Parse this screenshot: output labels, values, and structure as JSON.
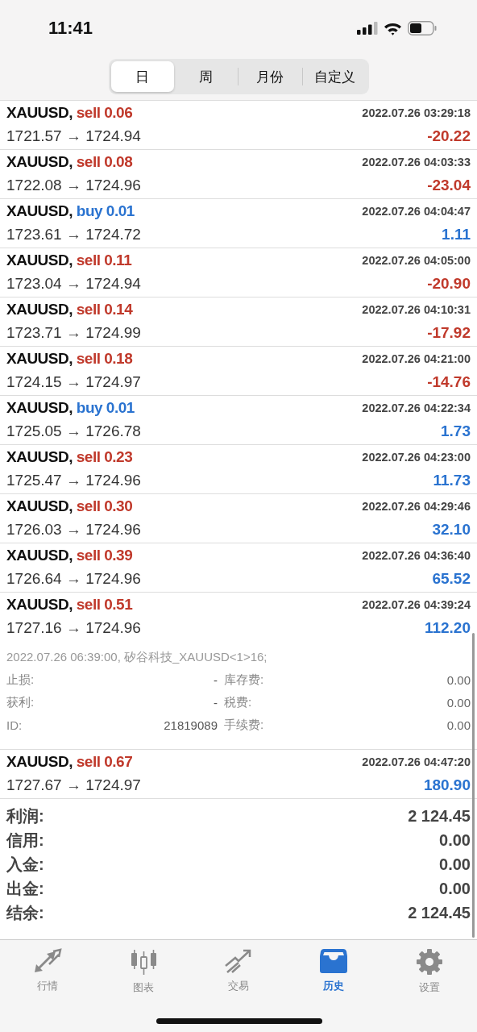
{
  "status_bar": {
    "time": "11:41"
  },
  "period_tabs": [
    {
      "label": "日",
      "selected": true
    },
    {
      "label": "周",
      "selected": false
    },
    {
      "label": "月份",
      "selected": false
    },
    {
      "label": "自定义",
      "selected": false
    }
  ],
  "deals": [
    {
      "symbol": "XAUUSD,",
      "type": "sell",
      "volume": "0.06",
      "time": "2022.07.26 03:29:18",
      "prices": "1721.57 → 1724.94",
      "profit": "-20.22",
      "negative": true
    },
    {
      "symbol": "XAUUSD,",
      "type": "sell",
      "volume": "0.08",
      "time": "2022.07.26 04:03:33",
      "prices": "1722.08 → 1724.96",
      "profit": "-23.04",
      "negative": true
    },
    {
      "symbol": "XAUUSD,",
      "type": "buy",
      "volume": "0.01",
      "time": "2022.07.26 04:04:47",
      "prices": "1723.61 → 1724.72",
      "profit": "1.11",
      "negative": false
    },
    {
      "symbol": "XAUUSD,",
      "type": "sell",
      "volume": "0.11",
      "time": "2022.07.26 04:05:00",
      "prices": "1723.04 → 1724.94",
      "profit": "-20.90",
      "negative": true
    },
    {
      "symbol": "XAUUSD,",
      "type": "sell",
      "volume": "0.14",
      "time": "2022.07.26 04:10:31",
      "prices": "1723.71 → 1724.99",
      "profit": "-17.92",
      "negative": true
    },
    {
      "symbol": "XAUUSD,",
      "type": "sell",
      "volume": "0.18",
      "time": "2022.07.26 04:21:00",
      "prices": "1724.15 → 1724.97",
      "profit": "-14.76",
      "negative": true
    },
    {
      "symbol": "XAUUSD,",
      "type": "buy",
      "volume": "0.01",
      "time": "2022.07.26 04:22:34",
      "prices": "1725.05 → 1726.78",
      "profit": "1.73",
      "negative": false
    },
    {
      "symbol": "XAUUSD,",
      "type": "sell",
      "volume": "0.23",
      "time": "2022.07.26 04:23:00",
      "prices": "1725.47 → 1724.96",
      "profit": "11.73",
      "negative": false
    },
    {
      "symbol": "XAUUSD,",
      "type": "sell",
      "volume": "0.30",
      "time": "2022.07.26 04:29:46",
      "prices": "1726.03 → 1724.96",
      "profit": "32.10",
      "negative": false
    },
    {
      "symbol": "XAUUSD,",
      "type": "sell",
      "volume": "0.39",
      "time": "2022.07.26 04:36:40",
      "prices": "1726.64 → 1724.96",
      "profit": "65.52",
      "negative": false
    },
    {
      "symbol": "XAUUSD,",
      "type": "sell",
      "volume": "0.51",
      "time": "2022.07.26 04:39:24",
      "prices": "1727.16 → 1724.96",
      "profit": "112.20",
      "negative": false,
      "details": {
        "comment": "2022.07.26 06:39:00, 矽谷科技_XAUUSD<1>16;",
        "fields": [
          {
            "label": "止损:",
            "value": "-",
            "label_2": "库存费:",
            "value_2": "0.00"
          },
          {
            "label": "获利:",
            "value": "-",
            "label_2": "税费:",
            "value_2": "0.00"
          },
          {
            "label": "ID:",
            "value": "21819089",
            "label_2": "手续费:",
            "value_2": "0.00"
          }
        ]
      }
    },
    {
      "symbol": "XAUUSD,",
      "type": "sell",
      "volume": "0.67",
      "time": "2022.07.26 04:47:20",
      "prices": "1727.67 → 1724.97",
      "profit": "180.90",
      "negative": false
    }
  ],
  "summary": [
    {
      "label": "利润:",
      "value": "2 124.45"
    },
    {
      "label": "信用:",
      "value": "0.00"
    },
    {
      "label": "入金:",
      "value": "0.00"
    },
    {
      "label": "出金:",
      "value": "0.00"
    },
    {
      "label": "结余:",
      "value": "2 124.45"
    }
  ],
  "bottom_tabs": [
    {
      "label": "行情",
      "kind": "quotes",
      "selected": false
    },
    {
      "label": "图表",
      "kind": "chart",
      "selected": false
    },
    {
      "label": "交易",
      "kind": "trade",
      "selected": false
    },
    {
      "label": "历史",
      "kind": "history",
      "selected": true
    },
    {
      "label": "设置",
      "kind": "settings",
      "selected": false
    }
  ]
}
